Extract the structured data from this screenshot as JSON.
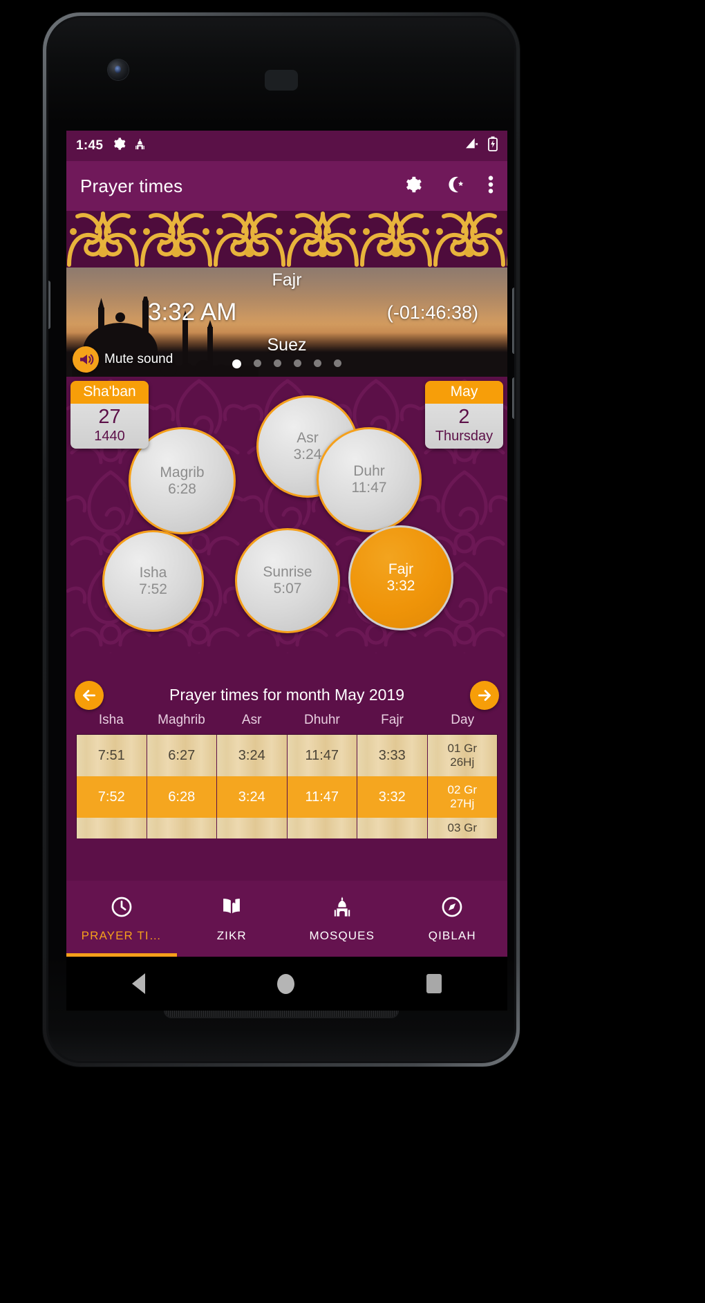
{
  "status_bar": {
    "clock": "1:45",
    "left_icons": [
      "gear-icon",
      "mosque-icon"
    ],
    "right_icons": [
      "signal-no-sim-icon",
      "battery-charging-icon"
    ]
  },
  "app_bar": {
    "title": "Prayer times",
    "actions": [
      "settings-gear-icon",
      "crescent-star-icon",
      "overflow-menu-icon"
    ]
  },
  "hero": {
    "prayer_name": "Fajr",
    "prayer_time": "3:32 AM",
    "countdown": "(-01:46:38)",
    "city": "Suez",
    "mute_label": "Mute sound",
    "mute_icon": "speaker-icon",
    "page_dots": 6,
    "active_dot": 1
  },
  "hijri_card": {
    "month": "Sha'ban",
    "day": "27",
    "year": "1440"
  },
  "gregorian_card": {
    "month": "May",
    "day": "2",
    "weekday": "Thursday"
  },
  "prayer_circles": [
    {
      "name": "Asr",
      "time": "3:24",
      "active": false
    },
    {
      "name": "Magrib",
      "time": "6:28",
      "active": false
    },
    {
      "name": "Duhr",
      "time": "11:47",
      "active": false
    },
    {
      "name": "Isha",
      "time": "7:52",
      "active": false
    },
    {
      "name": "Sunrise",
      "time": "5:07",
      "active": false
    },
    {
      "name": "Fajr",
      "time": "3:32",
      "active": true
    }
  ],
  "month_table": {
    "title": "Prayer times for month May 2019",
    "prev_label": "←",
    "next_label": "→",
    "columns": [
      "Isha",
      "Maghrib",
      "Asr",
      "Dhuhr",
      "Fajr",
      "Day"
    ],
    "rows": [
      {
        "isha": "7:51",
        "maghrib": "6:27",
        "asr": "3:24",
        "dhuhr": "11:47",
        "fajr": "3:33",
        "day_gr": "01 Gr",
        "day_hj": "26Hj",
        "highlight": false
      },
      {
        "isha": "7:52",
        "maghrib": "6:28",
        "asr": "3:24",
        "dhuhr": "11:47",
        "fajr": "3:32",
        "day_gr": "02 Gr",
        "day_hj": "27Hj",
        "highlight": true
      },
      {
        "isha": "",
        "maghrib": "",
        "asr": "",
        "dhuhr": "",
        "fajr": "",
        "day_gr": "03 Gr",
        "day_hj": "",
        "highlight": false
      }
    ]
  },
  "bottom_nav": [
    {
      "label": "PRAYER TI…",
      "icon": "clock-icon",
      "active": true
    },
    {
      "label": "ZIKR",
      "icon": "book-icon",
      "active": false
    },
    {
      "label": "MOSQUES",
      "icon": "mosque-icon",
      "active": false
    },
    {
      "label": "QIBLAH",
      "icon": "compass-icon",
      "active": false
    }
  ],
  "android_nav": {
    "back": "back-triangle-icon",
    "home": "home-circle-icon",
    "recents": "recents-square-icon"
  },
  "colors": {
    "primary": "#70195a",
    "primary_dark": "#5a1147",
    "background": "#5c1048",
    "accent": "#f5a01b",
    "accent_dark": "#f79e09",
    "table_row": "#e6d2a3",
    "table_highlight": "#f5a61f"
  }
}
